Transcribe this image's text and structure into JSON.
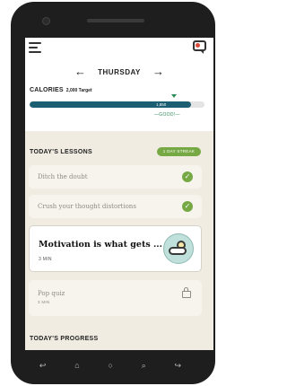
{
  "header": {
    "day": "THURSDAY",
    "prev_arrow": "←",
    "next_arrow": "→"
  },
  "calories": {
    "label": "CALORIES",
    "target": "2,000 Target",
    "value": "1,850",
    "status": "—GOOD!—",
    "fill_fraction": 0.925
  },
  "lessons": {
    "title": "TODAY'S LESSONS",
    "streak": "1 DAY STREAK",
    "items": [
      {
        "title": "Ditch the doubt",
        "state": "done"
      },
      {
        "title": "Crush your thought distortions",
        "state": "done"
      }
    ],
    "feature": {
      "title": "Motivation is what gets ...",
      "duration": "3 MIN"
    },
    "quiz": {
      "title": "Pop quiz",
      "duration": "3 MIN"
    }
  },
  "progress": {
    "title": "TODAY'S PROGRESS"
  },
  "icons": {
    "menu": "menu-icon",
    "chat": "chat-icon",
    "check": "✓",
    "weather": "sun-cloud-icon",
    "lock": "lock-icon"
  },
  "colors": {
    "accent_teal": "#1c5e72",
    "accent_green": "#76a944",
    "content_bg": "#f1ece2"
  },
  "system_nav": [
    "↩",
    "⌂",
    "○",
    "⌕",
    "↪"
  ]
}
